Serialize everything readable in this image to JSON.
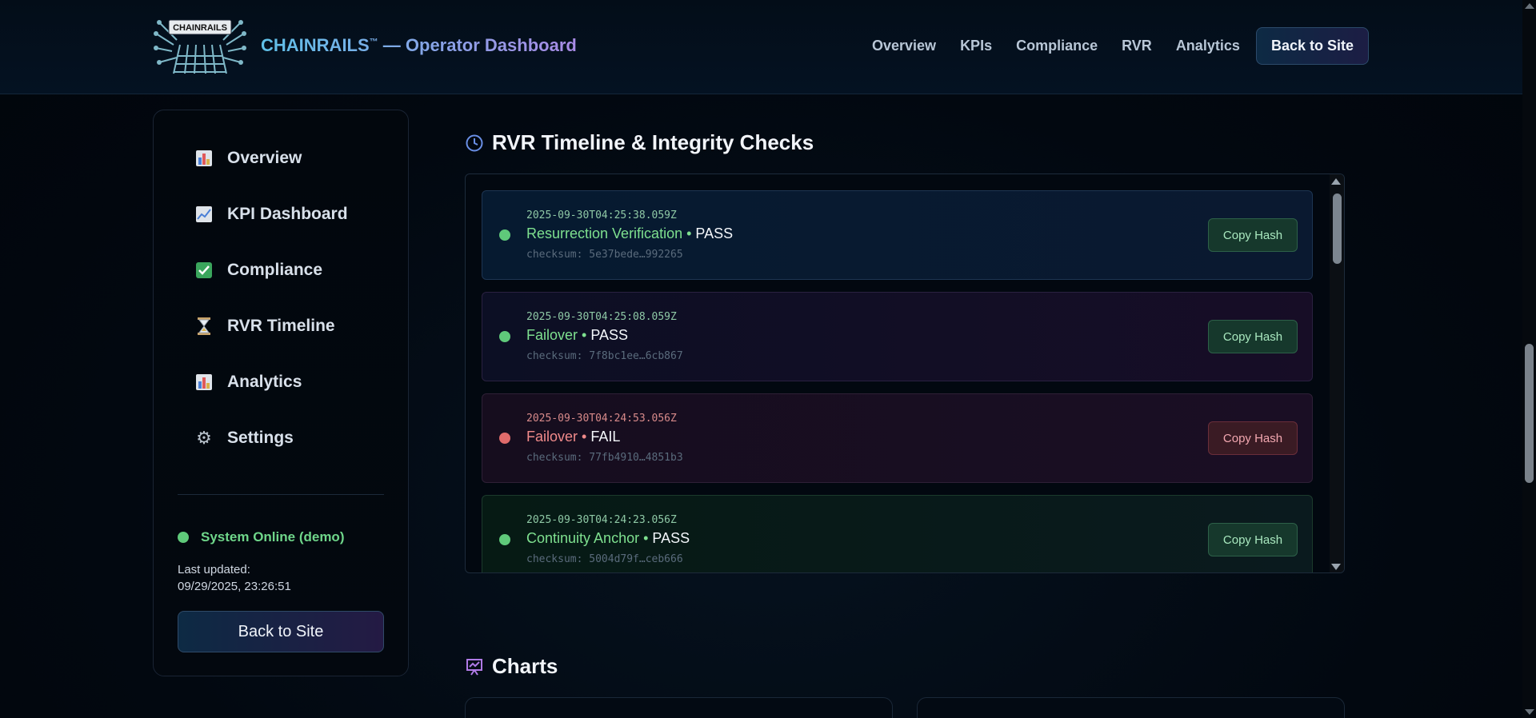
{
  "header": {
    "logo_text": "CHAINRAILS",
    "brand": "CHAINRAILS",
    "brand_tm": "™",
    "brand_suffix": " — Operator Dashboard",
    "nav": [
      "Overview",
      "KPIs",
      "Compliance",
      "RVR",
      "Analytics"
    ],
    "back_label": "Back to Site"
  },
  "sidebar": {
    "items": [
      {
        "label": "Overview",
        "icon": "bar-chart-icon"
      },
      {
        "label": "KPI Dashboard",
        "icon": "trend-chart-icon"
      },
      {
        "label": "Compliance",
        "icon": "check-box-icon"
      },
      {
        "label": "RVR Timeline",
        "icon": "hourglass-icon"
      },
      {
        "label": "Analytics",
        "icon": "bar-chart-icon"
      },
      {
        "label": "Settings",
        "icon": "gear-icon"
      }
    ],
    "status": "System Online (demo)",
    "updated_label": "Last updated:",
    "updated_value": "09/29/2025, 23:26:51",
    "back_label": "Back to Site"
  },
  "timeline": {
    "title": "RVR Timeline & Integrity Checks",
    "entries": [
      {
        "timestamp": "2025-09-30T04:25:38.059Z",
        "name": "Resurrection Verification",
        "sep": " • ",
        "result": "PASS",
        "checksum": "checksum: 5e37bede…992265",
        "button": "Copy Hash",
        "status": "pass"
      },
      {
        "timestamp": "2025-09-30T04:25:08.059Z",
        "name": "Failover",
        "sep": " • ",
        "result": "PASS",
        "checksum": "checksum: 7f8bc1ee…6cb867",
        "button": "Copy Hash",
        "status": "pass"
      },
      {
        "timestamp": "2025-09-30T04:24:53.056Z",
        "name": "Failover",
        "sep": " • ",
        "result": "FAIL",
        "checksum": "checksum: 77fb4910…4851b3",
        "button": "Copy Hash",
        "status": "fail"
      },
      {
        "timestamp": "2025-09-30T04:24:23.056Z",
        "name": "Continuity Anchor",
        "sep": " • ",
        "result": "PASS",
        "checksum": "checksum: 5004d79f…ceb666",
        "button": "Copy Hash",
        "status": "pass"
      }
    ]
  },
  "charts": {
    "title": "Charts"
  },
  "colors": {
    "pass": "#5fc97a",
    "fail": "#e06b6b",
    "brand_start": "#5fc1e8",
    "brand_end": "#a98be6"
  }
}
